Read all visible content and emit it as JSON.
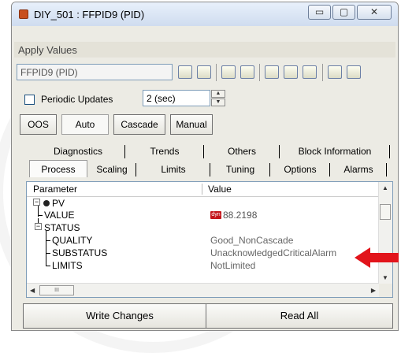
{
  "window": {
    "title": "DIY_501 : FFPID9 (PID)",
    "minimize_glyph": "▭",
    "maximize_glyph": "▢",
    "close_glyph": "✕"
  },
  "menu": {
    "apply_values": "Apply Values"
  },
  "toolbar": {
    "tag_value": "FFPID9 (PID)",
    "icons": [
      "block-icon",
      "block-edit-icon",
      "tree-icon",
      "glasses-icon",
      "chart-icon",
      "network-icon",
      "dots-icon",
      "list-view-icon",
      "detail-view-icon"
    ]
  },
  "options": {
    "periodic_updates_label": "Periodic Updates",
    "periodic_updates_checked": false,
    "interval_value": "2 (sec)",
    "modes": [
      "OOS",
      "Auto",
      "Cascade",
      "Manual"
    ],
    "active_mode": "Auto"
  },
  "tabs": {
    "row1": [
      "Diagnostics",
      "Trends",
      "Others",
      "Block Information"
    ],
    "row2": [
      "Process",
      "Scaling",
      "Limits",
      "Tuning",
      "Options",
      "Alarms"
    ],
    "selected": "Process"
  },
  "grid": {
    "columns": [
      "Parameter",
      "Value"
    ],
    "rows": [
      {
        "name": "PV",
        "value": ""
      },
      {
        "name": "VALUE",
        "value": "88.2198",
        "badge": "dyn"
      },
      {
        "name": "STATUS",
        "value": ""
      },
      {
        "name": "QUALITY",
        "value": "Good_NonCascade"
      },
      {
        "name": "SUBSTATUS",
        "value": "UnacknowledgedCriticalAlarm"
      },
      {
        "name": "LIMITS",
        "value": "NotLimited"
      }
    ],
    "hscroll_grip": "III",
    "up_arrow": "▲",
    "down_arrow": "▼",
    "left_arrow": "◀",
    "right_arrow": "▶"
  },
  "footer": {
    "write_changes": "Write Changes",
    "read_all": "Read All"
  },
  "colors": {
    "highlight_arrow": "#e2141b",
    "badge": "#c4161c"
  }
}
